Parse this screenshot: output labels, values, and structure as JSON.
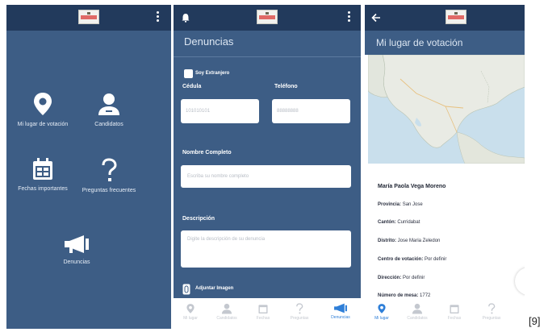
{
  "screen1": {
    "menu": [
      {
        "label": "Mi lugar de votación",
        "icon": "location-pin-icon"
      },
      {
        "label": "Candidatos",
        "icon": "person-icon"
      },
      {
        "label": "Fechas importantes",
        "icon": "calendar-icon"
      },
      {
        "label": "Preguntas frecuentes",
        "icon": "question-icon"
      },
      {
        "label": "Denuncias",
        "icon": "megaphone-icon"
      }
    ]
  },
  "screen2": {
    "title": "Denuncias",
    "foreigner_label": "Soy Extranjero",
    "cedula_label": "Cédula",
    "cedula_value": "101010101",
    "phone_label": "Teléfono",
    "phone_value": "88888888",
    "fullname_label": "Nombre Completo",
    "fullname_placeholder": "Escriba su nombre completo",
    "description_label": "Descripción",
    "description_placeholder": "Digite la descripción de su denuncia",
    "attach_label": "Adjuntar Imagen",
    "nav": [
      {
        "label": "Mi lugar",
        "active": false
      },
      {
        "label": "Candidatos",
        "active": false
      },
      {
        "label": "Fechas",
        "active": false
      },
      {
        "label": "Preguntas",
        "active": false
      },
      {
        "label": "Denuncias",
        "active": true
      }
    ]
  },
  "screen3": {
    "title": "Mi lugar de votación",
    "name": "María Paola Vega Moreno",
    "fields": [
      {
        "key": "Provincia:",
        "value": "San Jose"
      },
      {
        "key": "Cantón:",
        "value": "Curridabat"
      },
      {
        "key": "Distrito:",
        "value": "Jose Maria Zeledon"
      },
      {
        "key": "Centro de votación:",
        "value": "Por definir"
      },
      {
        "key": "Dirección:",
        "value": "Por definir"
      },
      {
        "key": "Número de mesa:",
        "value": "1772"
      }
    ],
    "nav": [
      {
        "label": "Mi lugar",
        "active": true
      },
      {
        "label": "Candidatos",
        "active": false
      },
      {
        "label": "Fechas",
        "active": false
      },
      {
        "label": "Preguntas",
        "active": false
      }
    ]
  },
  "figure_tag": "[9]",
  "colors": {
    "appbar": "#223a5c",
    "background": "#3d5d85",
    "accent": "#2f7fd8"
  }
}
